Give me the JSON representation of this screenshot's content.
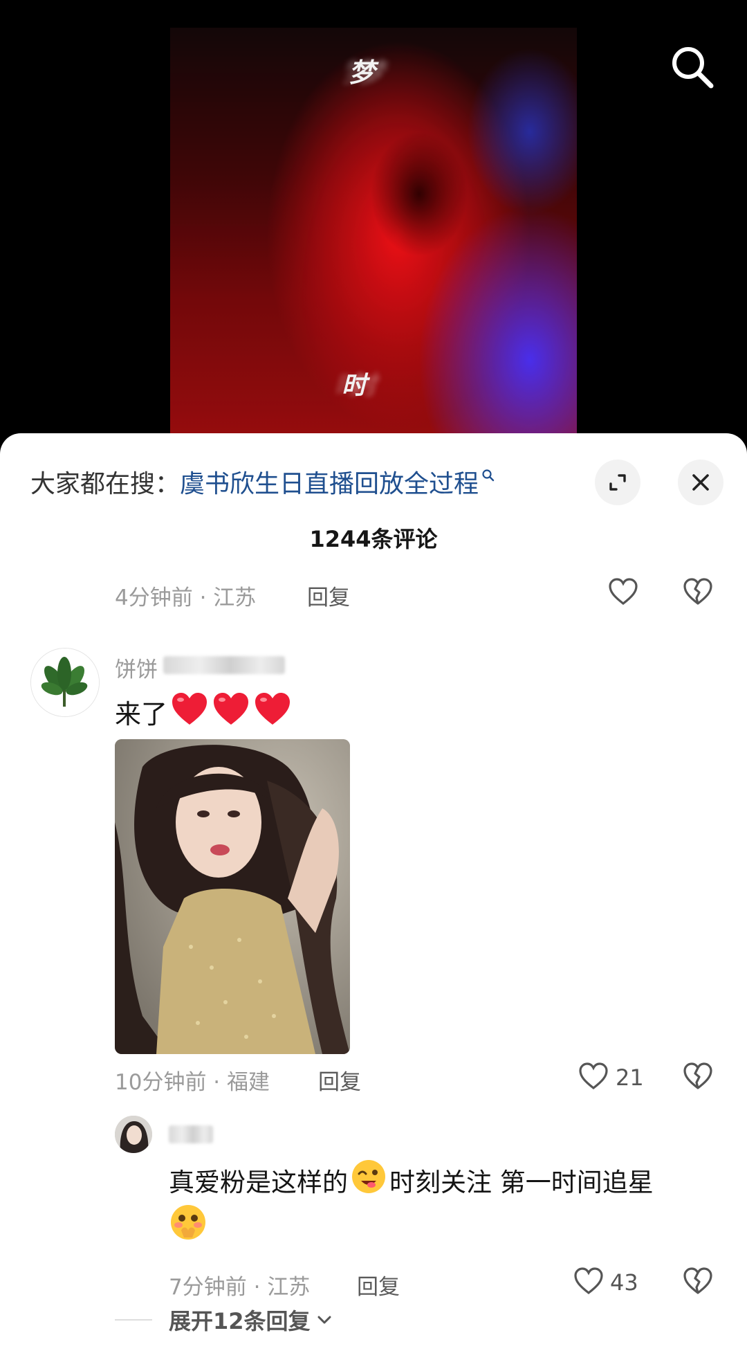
{
  "video": {
    "glyph_top": "梦",
    "glyph_bottom": "时"
  },
  "trending": {
    "prefix": "大家都在搜：",
    "query": "虞书欣生日直播回放全过程"
  },
  "comments_header": {
    "count_label": "1244条评论"
  },
  "comment_prev": {
    "meta": "4分钟前 · 江苏",
    "reply_label": "回复"
  },
  "comment_main": {
    "username": "饼饼",
    "text": "来了",
    "emoji_count": 3,
    "meta": "10分钟前 · 福建",
    "reply_label": "回复",
    "likes": "21"
  },
  "reply": {
    "text_line1": "真爱粉是这样的",
    "text_line1b": "时刻关注 第一时间追星",
    "meta": "7分钟前 · 江苏",
    "reply_label": "回复",
    "likes": "43"
  },
  "expand": {
    "label": "展开12条回复"
  },
  "colors": {
    "accent_link": "#1f4f8f",
    "meta_gray": "#9a9a9a",
    "heart_red": "#ee1d36"
  },
  "icons": [
    "search-icon",
    "search-small-icon",
    "expand-icon",
    "close-icon",
    "like-icon",
    "dislike-icon",
    "chevron-down-icon"
  ]
}
